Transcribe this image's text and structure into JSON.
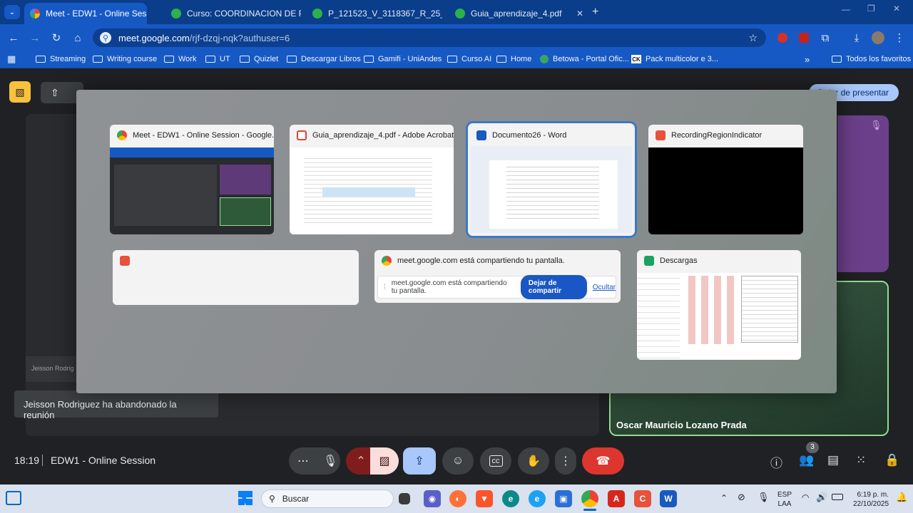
{
  "browser": {
    "tabs": [
      {
        "title": "Meet - EDW1 - Online Sessi",
        "color": "#34a853"
      },
      {
        "title": "Curso: COORDINACION DE PR",
        "color": "#2bb24c"
      },
      {
        "title": "P_121523_V_3118367_R_25_C_9",
        "color": "#2bb24c"
      },
      {
        "title": "Guia_aprendizaje_4.pdf",
        "color": "#2bb24c"
      }
    ],
    "url_host": "meet.google.com",
    "url_path": "/rjf-dzqj-nqk?authuser=6",
    "bookmarks": [
      "Streaming",
      "Writing course",
      "Work",
      "UT",
      "Quizlet",
      "Descargar Libros",
      "Gamifi - UniAndes",
      "Curso AI",
      "Home",
      "Betowa - Portal Ofic...",
      "Pack multicolor e 3...",
      "Todos los favoritos"
    ],
    "more_bookmarks": "»"
  },
  "meet": {
    "present_button": "Dejar de presentar",
    "participant_name": "Oscar Mauricio Lozano Prada",
    "left_participant_short": "Jeisson Rodrig",
    "toast": "Jeisson Rodriguez ha abandonado la reunión",
    "time": "18:19",
    "meeting_name": "EDW1 - Online Session",
    "participants_count": "3"
  },
  "picker": {
    "windows": [
      {
        "title": "Meet - EDW1 - Online Session - Google...",
        "icon_color": "#4285f4"
      },
      {
        "title": "Guia_aprendizaje_4.pdf - Adobe Acrobat...",
        "icon_color": "#e34133"
      },
      {
        "title": "Documento26 - Word",
        "icon_color": "#185abd"
      },
      {
        "title": "RecordingRegionIndicator",
        "icon_color": "#e8513a"
      },
      {
        "title": "",
        "icon_color": "#e8513a"
      },
      {
        "title": "meet.google.com está compartiendo tu pantalla.",
        "icon_color": "#4285f4"
      },
      {
        "title": "Descargas",
        "icon_color": "#1aa260"
      }
    ],
    "share_bar": {
      "text": "meet.google.com está compartiendo tu pantalla.",
      "stop": "Dejar de compartir",
      "hide": "Ocultar"
    }
  },
  "taskbar": {
    "search": "Buscar",
    "lang1": "ESP",
    "lang2": "LAA",
    "time": "6:19 p. m.",
    "date": "22/10/2025"
  }
}
